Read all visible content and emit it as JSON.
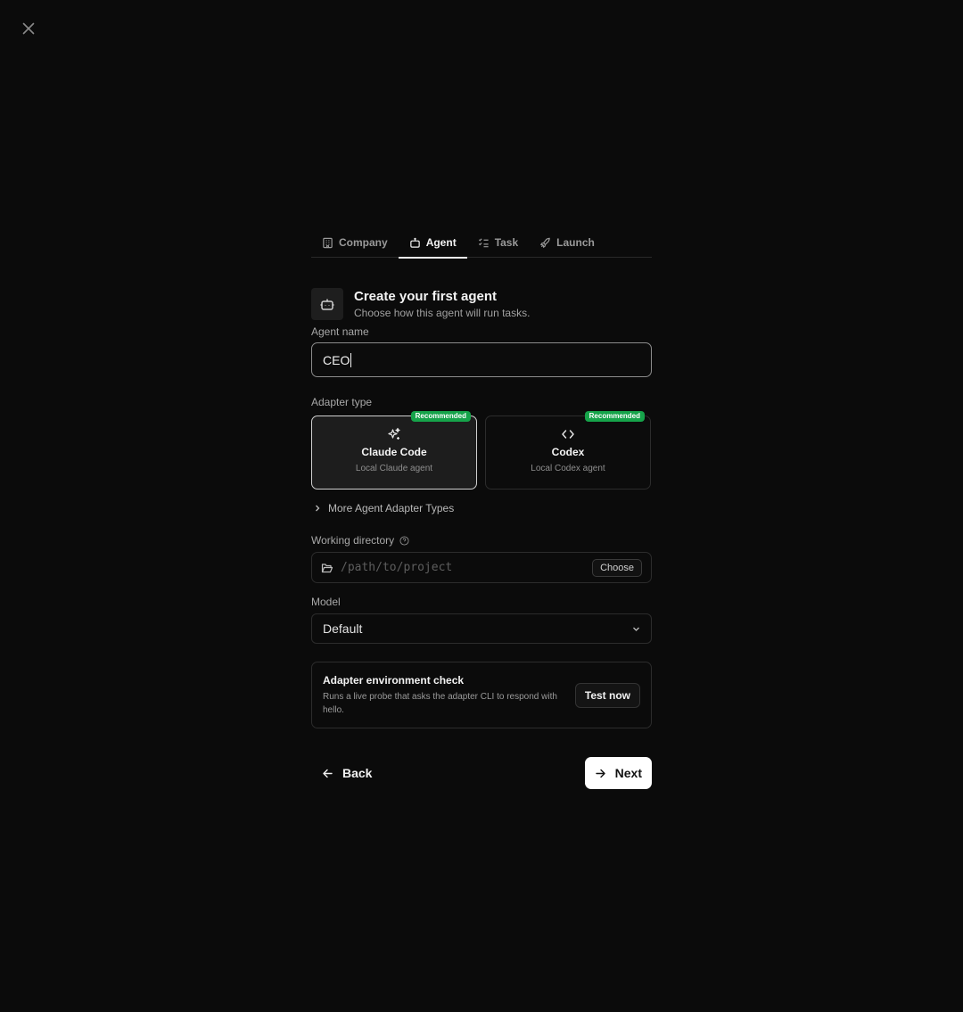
{
  "tabs": [
    {
      "label": "Company",
      "icon": "building-icon",
      "active": false
    },
    {
      "label": "Agent",
      "icon": "bot-icon",
      "active": true
    },
    {
      "label": "Task",
      "icon": "list-checks-icon",
      "active": false
    },
    {
      "label": "Launch",
      "icon": "rocket-icon",
      "active": false
    }
  ],
  "heading": {
    "title": "Create your first agent",
    "subtitle": "Choose how this agent will run tasks."
  },
  "agent_name": {
    "label": "Agent name",
    "value": "CEO"
  },
  "adapter": {
    "label": "Adapter type",
    "cards": [
      {
        "title": "Claude Code",
        "subtitle": "Local Claude agent",
        "badge": "Recommended",
        "selected": true
      },
      {
        "title": "Codex",
        "subtitle": "Local Codex agent",
        "badge": "Recommended",
        "selected": false
      }
    ],
    "more_label": "More Agent Adapter Types"
  },
  "working_directory": {
    "label": "Working directory",
    "placeholder": "/path/to/project",
    "choose_label": "Choose"
  },
  "model": {
    "label": "Model",
    "value": "Default"
  },
  "env_check": {
    "title": "Adapter environment check",
    "description": "Runs a live probe that asks the adapter CLI to respond with hello.",
    "button_label": "Test now"
  },
  "footer": {
    "back_label": "Back",
    "next_label": "Next"
  },
  "colors": {
    "background": "#0b0b0b",
    "badge": "#16a34a",
    "primary_button": "#ffffff"
  }
}
